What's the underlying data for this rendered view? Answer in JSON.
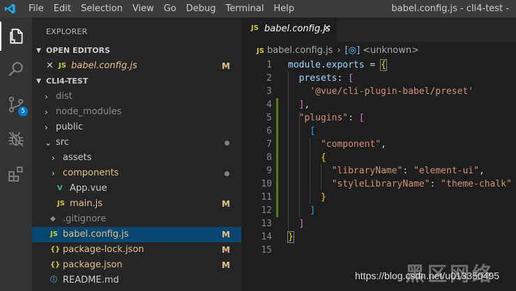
{
  "titlebar": {
    "menu": [
      "File",
      "Edit",
      "Selection",
      "View",
      "Go",
      "Debug",
      "Terminal",
      "Help"
    ],
    "window_title": "babel.config.js - cli4-test -"
  },
  "activity_bar": {
    "items": [
      {
        "icon": "files-icon",
        "active": true
      },
      {
        "icon": "search-icon"
      },
      {
        "icon": "source-control-icon",
        "badge": "5"
      },
      {
        "icon": "debug-icon"
      },
      {
        "icon": "extensions-icon"
      }
    ]
  },
  "sidebar": {
    "title": "EXPLORER",
    "open_editors": {
      "header": "OPEN EDITORS",
      "items": [
        {
          "close": "✕",
          "icon": "JS",
          "name": "babel.config.js",
          "status": "M"
        }
      ]
    },
    "project": {
      "header": "CLI4-TEST",
      "items": [
        {
          "name": "dist",
          "type": "folder",
          "depth": 1,
          "status": ""
        },
        {
          "name": "node_modules",
          "type": "folder",
          "depth": 1,
          "status": ""
        },
        {
          "name": "public",
          "type": "folder",
          "depth": 1,
          "status": ""
        },
        {
          "name": "src",
          "type": "folder-open",
          "depth": 1,
          "status": "dot"
        },
        {
          "name": "assets",
          "type": "folder",
          "depth": 2,
          "status": ""
        },
        {
          "name": "components",
          "type": "folder",
          "depth": 2,
          "status": "dot"
        },
        {
          "name": "App.vue",
          "type": "vue",
          "depth": 2,
          "icon": "V",
          "status": ""
        },
        {
          "name": "main.js",
          "type": "js",
          "depth": 2,
          "icon": "JS",
          "status": "M"
        },
        {
          "name": ".gitignore",
          "type": "git",
          "depth": 1,
          "icon": "◆",
          "status": ""
        },
        {
          "name": "babel.config.js",
          "type": "js",
          "depth": 1,
          "icon": "JS",
          "status": "M",
          "selected": true
        },
        {
          "name": "package-lock.json",
          "type": "json",
          "depth": 1,
          "icon": "{}",
          "status": "M"
        },
        {
          "name": "package.json",
          "type": "json",
          "depth": 1,
          "icon": "{}",
          "status": "M"
        },
        {
          "name": "README.md",
          "type": "info",
          "depth": 1,
          "icon": "ⓘ",
          "status": ""
        }
      ]
    }
  },
  "editor": {
    "tab": {
      "icon": "JS",
      "label": "babel.config.js",
      "close": "✕"
    },
    "breadcrumb": {
      "file_icon": "JS",
      "file": "babel.config.js",
      "separator": "›",
      "symbol_icon": "[◎]",
      "symbol": "<unknown>"
    },
    "lines": [
      [
        [
          "k",
          "module"
        ],
        [
          "p",
          "."
        ],
        [
          "k",
          "exports"
        ],
        [
          "p",
          " = "
        ],
        [
          "b1",
          "{"
        ]
      ],
      [
        [
          "p",
          "  "
        ],
        [
          "k",
          "presets"
        ],
        [
          "p",
          ": "
        ],
        [
          "b2",
          "["
        ]
      ],
      [
        [
          "p",
          "    "
        ],
        [
          "s",
          "'@vue/cli-plugin-babel/preset'"
        ]
      ],
      [
        [
          "p",
          "  "
        ],
        [
          "b2",
          "]"
        ],
        [
          "p",
          ","
        ]
      ],
      [
        [
          "p",
          "  "
        ],
        [
          "s",
          "\"plugins\""
        ],
        [
          "p",
          ": "
        ],
        [
          "b2",
          "["
        ]
      ],
      [
        [
          "p",
          "    "
        ],
        [
          "b3",
          "["
        ]
      ],
      [
        [
          "p",
          "      "
        ],
        [
          "s",
          "\"component\""
        ],
        [
          "p",
          ","
        ]
      ],
      [
        [
          "p",
          "      "
        ],
        [
          "b1",
          "{"
        ]
      ],
      [
        [
          "p",
          "        "
        ],
        [
          "s",
          "\"libraryName\""
        ],
        [
          "p",
          ": "
        ],
        [
          "s",
          "\"element-ui\""
        ],
        [
          "p",
          ","
        ]
      ],
      [
        [
          "p",
          "        "
        ],
        [
          "s",
          "\"styleLibraryName\""
        ],
        [
          "p",
          ": "
        ],
        [
          "s",
          "\"theme-chalk\""
        ]
      ],
      [
        [
          "p",
          "      "
        ],
        [
          "b1",
          "}"
        ]
      ],
      [
        [
          "p",
          "    "
        ],
        [
          "b3",
          "]"
        ]
      ],
      [
        [
          "p",
          "  "
        ],
        [
          "b2",
          "]"
        ]
      ],
      [
        [
          "b1",
          "}"
        ]
      ],
      []
    ]
  },
  "watermark": {
    "url": "https://blog.csdn.net/u013350495",
    "brand": "黑区网络"
  }
}
